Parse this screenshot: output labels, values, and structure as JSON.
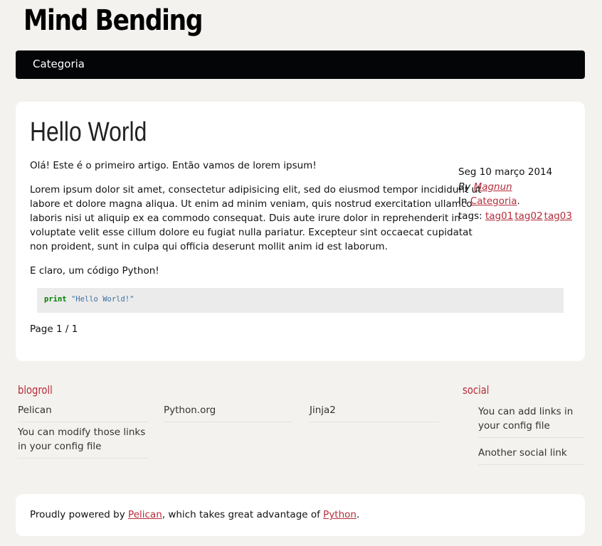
{
  "site": {
    "title": "Mind Bending"
  },
  "nav": {
    "items": [
      {
        "label": "Categoria"
      }
    ]
  },
  "article": {
    "title": "Hello World",
    "intro": "Olá! Este é o primeiro artigo. Então vamos de lorem ipsum!",
    "body": "Lorem ipsum dolor sit amet, consectetur adipisicing elit, sed do eiusmod tempor incididunt ut labore et dolore magna aliqua. Ut enim ad minim veniam, quis nostrud exercitation ullamco laboris nisi ut aliquip ex ea commodo consequat. Duis aute irure dolor in reprehenderit in voluptate velit esse cillum dolore eu fugiat nulla pariatur. Excepteur sint occaecat cupidatat non proident, sunt in culpa qui officia deserunt mollit anim id est laborum.",
    "code_intro": "E claro, um código Python!",
    "code": {
      "keyword": "print",
      "string": "\"Hello World!\""
    },
    "meta": {
      "date": "Seg 10 março 2014",
      "by_prefix": "By",
      "author": "Magnun",
      "in_prefix": "In",
      "category": "Categoria",
      "category_suffix": ".",
      "tags_prefix": "tags:",
      "tags": [
        "tag01",
        "tag02",
        "tag03"
      ]
    },
    "pager": "Page 1 / 1"
  },
  "blogroll": {
    "heading": "blogroll",
    "links": [
      "Pelican",
      "Python.org",
      "Jinja2",
      "You can modify those links in your config file"
    ]
  },
  "social": {
    "heading": "social",
    "links": [
      "You can add links in your config file",
      "Another social link"
    ]
  },
  "footer": {
    "prefix": "Proudly powered by",
    "pelican": "Pelican",
    "middle": ", which takes great advantage of",
    "python": "Python",
    "suffix": "."
  },
  "colors": {
    "accent": "#b52c3a",
    "navbar": "#030507",
    "background": "#f4f2ee"
  }
}
